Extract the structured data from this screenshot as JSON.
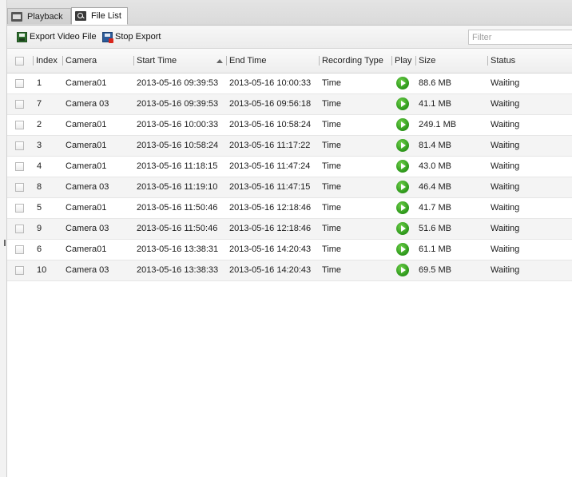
{
  "tabs": [
    {
      "label": "Playback",
      "icon": "film-icon",
      "active": false
    },
    {
      "label": "File List",
      "icon": "file-list-icon",
      "active": true
    }
  ],
  "toolbar": {
    "export_label": "Export Video File",
    "export_icon": "export-video-icon",
    "stop_label": "Stop Export",
    "stop_icon": "stop-export-icon",
    "filter_placeholder": "Filter",
    "filter_value": ""
  },
  "table": {
    "columns": [
      "Index",
      "Camera",
      "Start Time",
      "End Time",
      "Recording Type",
      "Play",
      "Size",
      "Status"
    ],
    "sort_column": "Start Time",
    "sort_direction": "ascending",
    "rows": [
      {
        "index": "1",
        "camera": "Camera01",
        "start": "2013-05-16 09:39:53",
        "end": "2013-05-16 10:00:33",
        "type": "Time",
        "size": "88.6 MB",
        "status": "Waiting"
      },
      {
        "index": "7",
        "camera": "Camera 03",
        "start": "2013-05-16 09:39:53",
        "end": "2013-05-16 09:56:18",
        "type": "Time",
        "size": "41.1 MB",
        "status": "Waiting"
      },
      {
        "index": "2",
        "camera": "Camera01",
        "start": "2013-05-16 10:00:33",
        "end": "2013-05-16 10:58:24",
        "type": "Time",
        "size": "249.1 MB",
        "status": "Waiting"
      },
      {
        "index": "3",
        "camera": "Camera01",
        "start": "2013-05-16 10:58:24",
        "end": "2013-05-16 11:17:22",
        "type": "Time",
        "size": "81.4 MB",
        "status": "Waiting"
      },
      {
        "index": "4",
        "camera": "Camera01",
        "start": "2013-05-16 11:18:15",
        "end": "2013-05-16 11:47:24",
        "type": "Time",
        "size": "43.0 MB",
        "status": "Waiting"
      },
      {
        "index": "8",
        "camera": "Camera 03",
        "start": "2013-05-16 11:19:10",
        "end": "2013-05-16 11:47:15",
        "type": "Time",
        "size": "46.4 MB",
        "status": "Waiting"
      },
      {
        "index": "5",
        "camera": "Camera01",
        "start": "2013-05-16 11:50:46",
        "end": "2013-05-16 12:18:46",
        "type": "Time",
        "size": "41.7 MB",
        "status": "Waiting"
      },
      {
        "index": "9",
        "camera": "Camera 03",
        "start": "2013-05-16 11:50:46",
        "end": "2013-05-16 12:18:46",
        "type": "Time",
        "size": "51.6 MB",
        "status": "Waiting"
      },
      {
        "index": "6",
        "camera": "Camera01",
        "start": "2013-05-16 13:38:31",
        "end": "2013-05-16 14:20:43",
        "type": "Time",
        "size": "61.1 MB",
        "status": "Waiting"
      },
      {
        "index": "10",
        "camera": "Camera 03",
        "start": "2013-05-16 13:38:33",
        "end": "2013-05-16 14:20:43",
        "type": "Time",
        "size": "69.5 MB",
        "status": "Waiting"
      }
    ]
  },
  "colors": {
    "play_button": "#2f9a1c",
    "row_alt": "#f4f4f4",
    "tab_bar": "#dadada"
  }
}
